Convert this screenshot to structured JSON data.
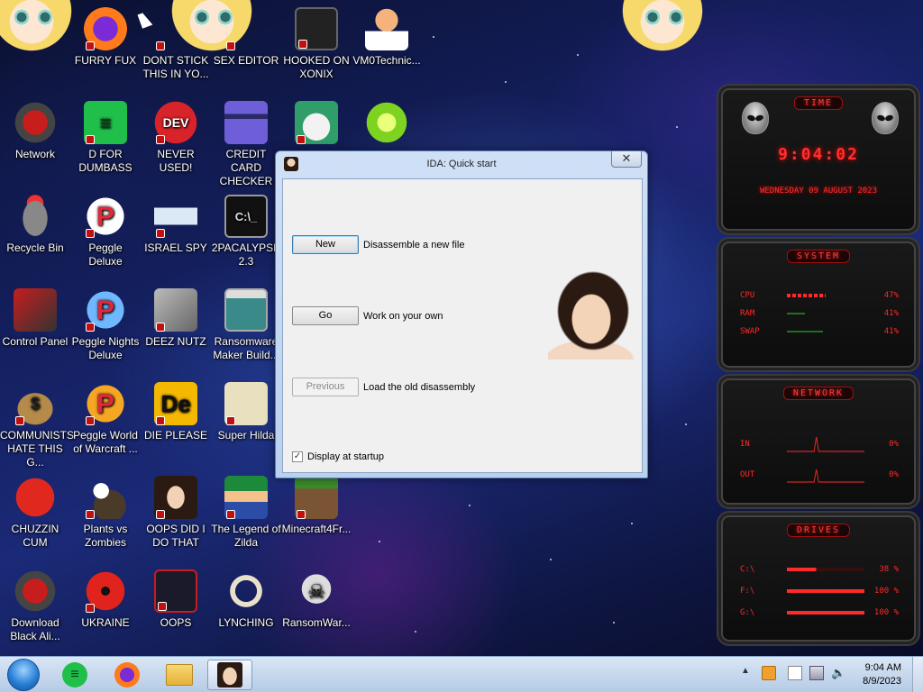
{
  "desktop": {
    "icons": [
      {
        "label": "FURRY FUX"
      },
      {
        "label": "DONT STICK THIS IN YO..."
      },
      {
        "label": "SEX EDITOR"
      },
      {
        "label": "HOOKED ON XONIX"
      },
      {
        "label": "VM0Technic..."
      },
      {
        "label": "Network"
      },
      {
        "label": "D FOR DUMBASS"
      },
      {
        "label": "NEVER USED!"
      },
      {
        "label": "CREDIT CARD CHECKER"
      },
      {
        "label": "Recycle Bin"
      },
      {
        "label": "Peggle Deluxe"
      },
      {
        "label": "ISRAEL SPY"
      },
      {
        "label": "2PACALYPSE 2.3"
      },
      {
        "label": "Control Panel"
      },
      {
        "label": "Peggle Nights Deluxe"
      },
      {
        "label": "DEEZ NUTZ"
      },
      {
        "label": "Ransomware Maker Build..."
      },
      {
        "label": "COMMUNISTS HATE THIS G..."
      },
      {
        "label": "Peggle World of Warcraft ..."
      },
      {
        "label": "DIE PLEASE"
      },
      {
        "label": "Super Hilda"
      },
      {
        "label": "CHUZZIN CUM"
      },
      {
        "label": "Plants vs Zombies"
      },
      {
        "label": "OOPS DID I DO THAT"
      },
      {
        "label": "The Legend of Zilda"
      },
      {
        "label": "Minecraft4Fr..."
      },
      {
        "label": "Download Black Ali..."
      },
      {
        "label": "UKRAINE"
      },
      {
        "label": "OOPS"
      },
      {
        "label": "LYNCHING"
      },
      {
        "label": "RansomWar..."
      }
    ]
  },
  "dialog": {
    "title": "IDA: Quick start",
    "close_label": "✕",
    "new_label": "New",
    "new_desc": "Disassemble a new file",
    "go_label": "Go",
    "go_desc": "Work on your own",
    "previous_label": "Previous",
    "previous_desc": "Load the old disassembly",
    "startup_label": "Display at startup",
    "startup_checked": true
  },
  "gadgets": {
    "time": {
      "title": "TIME",
      "clock": "9:04:02",
      "date": "WEDNESDAY 09 AUGUST 2023"
    },
    "system": {
      "title": "SYSTEM",
      "rows": [
        {
          "key": "CPU",
          "value": "47%"
        },
        {
          "key": "RAM",
          "value": "41%"
        },
        {
          "key": "SWAP",
          "value": "41%"
        }
      ]
    },
    "network": {
      "title": "NETWORK",
      "rows": [
        {
          "key": "IN",
          "value": "0%"
        },
        {
          "key": "OUT",
          "value": "0%"
        }
      ]
    },
    "drives": {
      "title": "DRIVES",
      "rows": [
        {
          "key": "C:\\",
          "value": "38 %"
        },
        {
          "key": "F:\\",
          "value": "100 %"
        },
        {
          "key": "G:\\",
          "value": "100 %"
        }
      ]
    }
  },
  "taskbar": {
    "time": "9:04 AM",
    "date": "8/9/2023"
  },
  "colors": {
    "accent_red": "#ff2a2a",
    "window_frame": "#b9d1ef"
  }
}
